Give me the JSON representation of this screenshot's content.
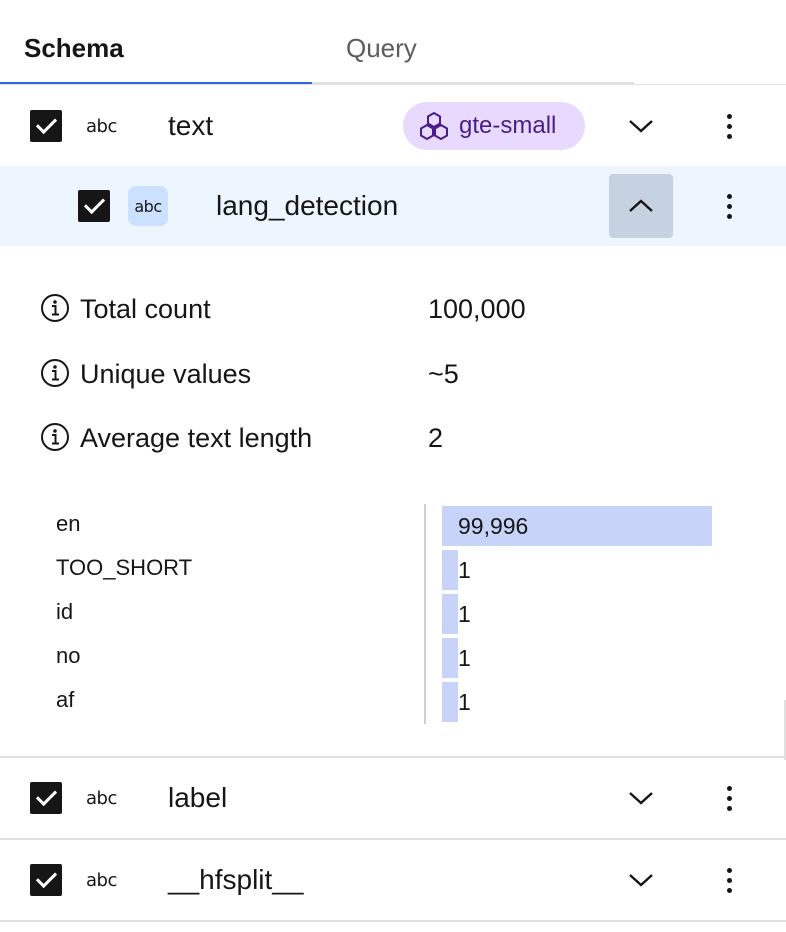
{
  "tabs": [
    {
      "label": "Schema",
      "active": true
    },
    {
      "label": "Query",
      "active": false
    }
  ],
  "fields": {
    "text": {
      "type": "abc",
      "name": "text",
      "checked": true,
      "embedding_tag": "gte-small",
      "expanded": false
    },
    "lang_detection": {
      "type": "abc",
      "name": "lang_detection",
      "checked": true,
      "expanded": true
    },
    "label": {
      "type": "abc",
      "name": "label",
      "checked": true,
      "expanded": false
    },
    "hfsplit": {
      "type": "abc",
      "name": "__hfsplit__",
      "checked": true,
      "expanded": false
    }
  },
  "stats": [
    {
      "label": "Total count",
      "value": "100,000"
    },
    {
      "label": "Unique values",
      "value": "~5"
    },
    {
      "label": "Average text length",
      "value": "2"
    }
  ],
  "chart_data": {
    "type": "bar",
    "orientation": "horizontal",
    "categories": [
      "en",
      "TOO_SHORT",
      "id",
      "no",
      "af"
    ],
    "values": [
      99996
    ],
    "value_labels": [
      "99,996",
      "1",
      "1",
      "1",
      "1"
    ]
  },
  "icons": {
    "checkbox": "checkbox-checked-icon",
    "embedding": "embedding-icon",
    "expand": "chevron-down-icon",
    "collapse": "chevron-up-icon",
    "menu": "overflow-menu-icon",
    "info": "information-icon"
  },
  "colors": {
    "tab_active_underline": "#2f66e0",
    "tag_bg": "#e8daff",
    "tag_text": "#491d8b",
    "sub_row_bg": "#edf5ff",
    "type_chip_bg": "#cce0ff",
    "bar_fill": "#c8d3fa"
  }
}
